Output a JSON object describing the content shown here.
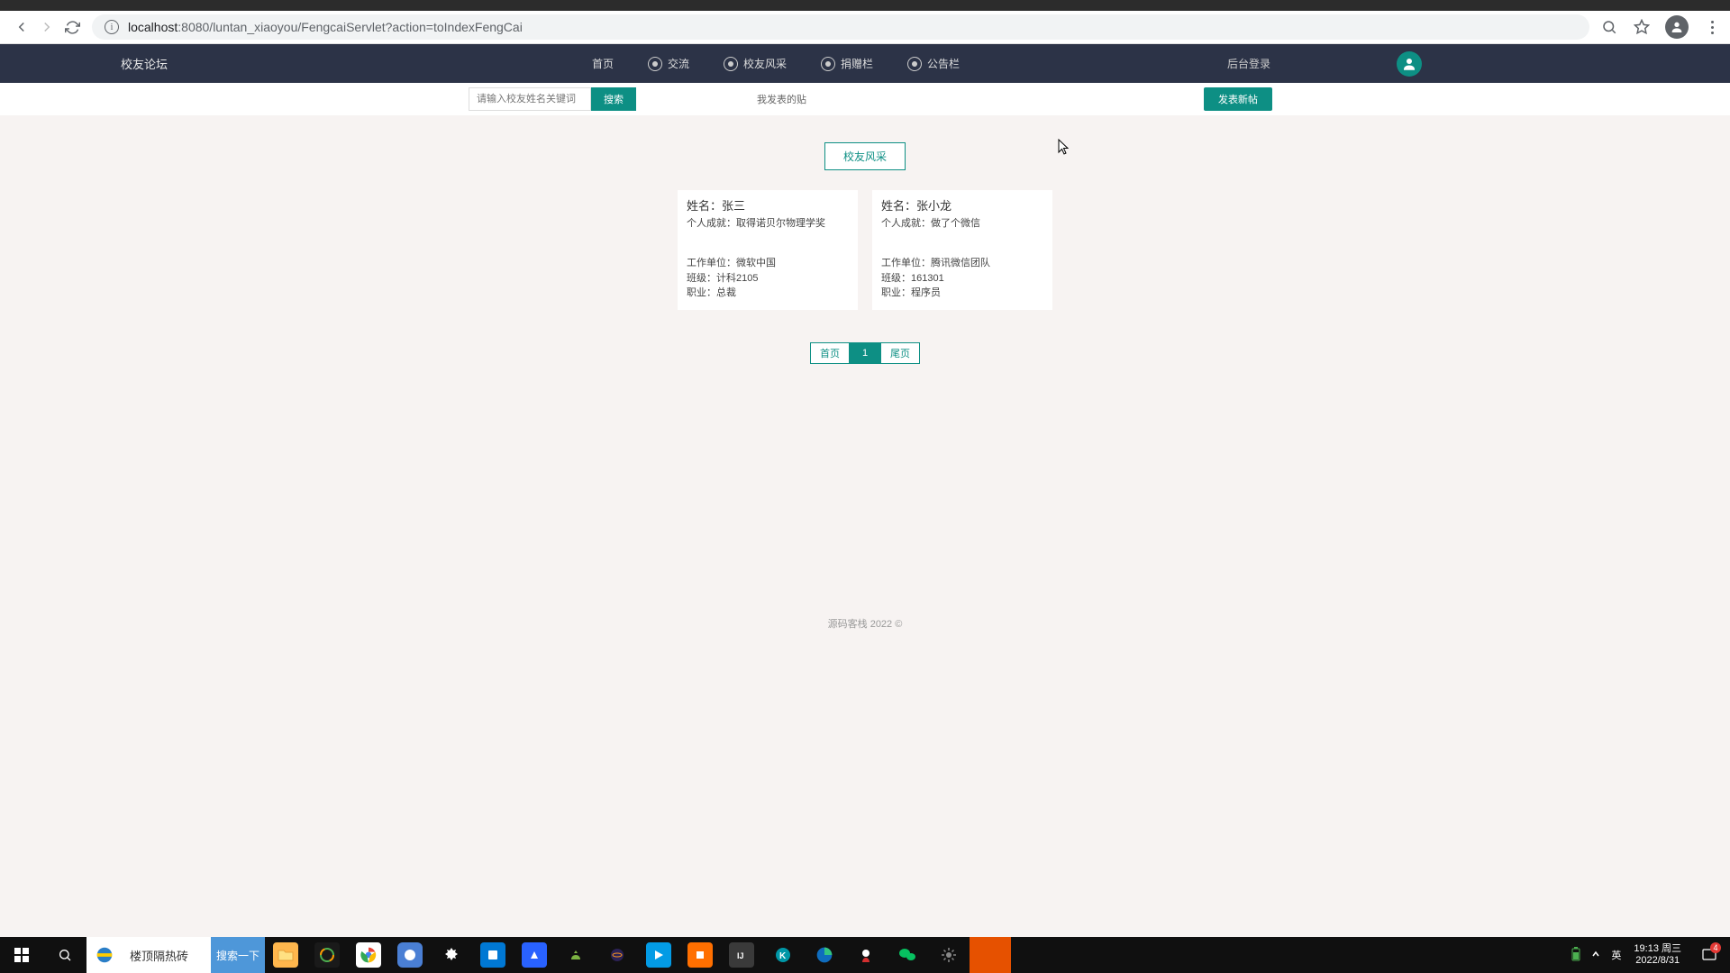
{
  "browser": {
    "url_host": "localhost",
    "url_rest": ":8080/luntan_xiaoyou/FengcaiServlet?action=toIndexFengCai"
  },
  "header": {
    "logo": "校友论坛",
    "nav": {
      "home": "首页",
      "exchange": "交流",
      "fengcai": "校友风采",
      "donate": "捐赠栏",
      "notice": "公告栏"
    },
    "admin_login": "后台登录"
  },
  "searchbar": {
    "placeholder": "请输入校友姓名关键词",
    "search_btn": "搜索",
    "my_posts": "我发表的贴",
    "new_post": "发表新帖"
  },
  "section_title": "校友风采",
  "labels": {
    "name": "姓名：",
    "achieve": "个人成就：",
    "workunit": "工作单位：",
    "classno": "班级：",
    "job": "职业："
  },
  "cards": [
    {
      "name": "张三",
      "achieve": "取得诺贝尔物理学奖",
      "workunit": "微软中国",
      "classno": "计科2105",
      "job": "总裁"
    },
    {
      "name": "张小龙",
      "achieve": "做了个微信",
      "workunit": "腾讯微信团队",
      "classno": "161301",
      "job": "程序员"
    }
  ],
  "pagination": {
    "first": "首页",
    "current": "1",
    "last": "尾页"
  },
  "footer": {
    "text": "源码客栈  2022 ©"
  },
  "taskbar": {
    "search_value": "楼顶隔热砖",
    "search_btn": "搜索一下",
    "tray": {
      "ime": "英",
      "time": "19:13 周三",
      "date": "2022/8/31",
      "notif_count": "4"
    }
  },
  "colors": {
    "accent": "#0d8f84",
    "header_bg": "#2c3347"
  }
}
